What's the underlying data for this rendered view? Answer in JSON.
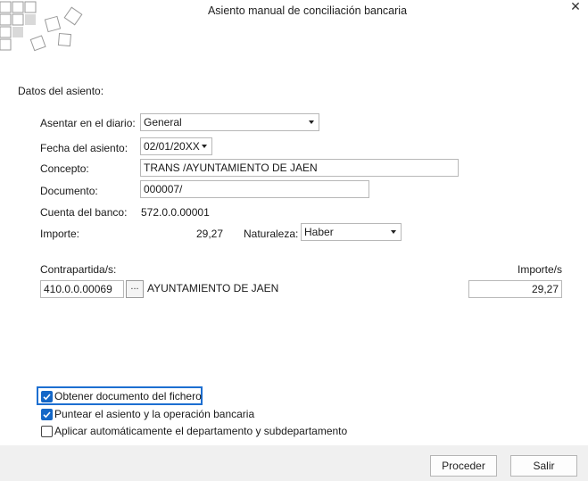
{
  "window": {
    "title": "Asiento manual de conciliación bancaria",
    "close_glyph": "✕"
  },
  "section": {
    "heading": "Datos del asiento:"
  },
  "form": {
    "diario_label": "Asentar en el diario:",
    "diario_value": "General",
    "fecha_label": "Fecha del asiento:",
    "fecha_value": "02/01/20XX",
    "concepto_label": "Concepto:",
    "concepto_value": "TRANS /AYUNTAMIENTO DE JAEN",
    "documento_label": "Documento:",
    "documento_value": "000007/",
    "cuenta_label": "Cuenta del banco:",
    "cuenta_value": "572.0.0.00001",
    "importe_label": "Importe:",
    "importe_value": "29,27",
    "naturaleza_label": "Naturaleza:",
    "naturaleza_value": "Haber"
  },
  "contrapartida": {
    "label": "Contrapartida/s:",
    "importe_header": "Importe/s",
    "account": "410.0.0.00069",
    "browse_label": "...",
    "name": "AYUNTAMIENTO DE JAEN",
    "importe": "29,27"
  },
  "options": [
    {
      "label": "Obtener documento del fichero",
      "checked": true
    },
    {
      "label": "Puntear el asiento y la operación bancaria",
      "checked": true
    },
    {
      "label": "Aplicar automáticamente el departamento y subdepartamento",
      "checked": false
    }
  ],
  "buttons": {
    "proceder": "Proceder",
    "salir": "Salir"
  },
  "colors": {
    "accent": "#1467c7",
    "footer_bg": "#f0f0f0"
  },
  "icons": {
    "logo": "tiles-logo-icon",
    "close": "close-icon",
    "dropdown": "chevron-down-icon",
    "check": "checkmark-icon"
  }
}
